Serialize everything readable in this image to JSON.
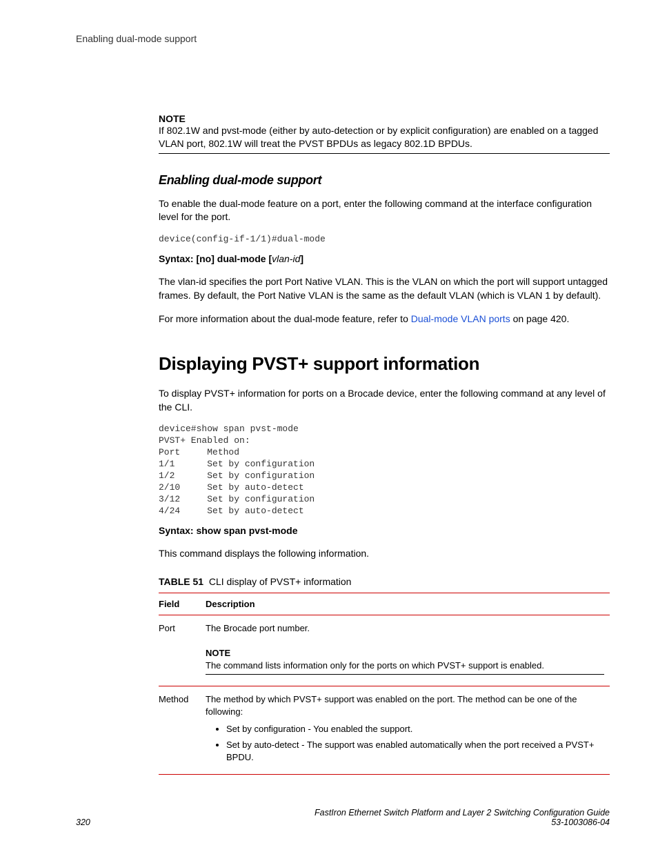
{
  "header": "Enabling dual-mode support",
  "note1": {
    "label": "NOTE",
    "text": "If 802.1W and pvst-mode (either by auto-detection or by explicit configuration) are enabled on a tagged VLAN port, 802.1W will treat the PVST BPDUs as legacy 802.1D BPDUs."
  },
  "section1": {
    "heading": "Enabling dual-mode support",
    "intro": "To enable the dual-mode feature on a port, enter the following command at the interface configuration level for the port.",
    "code": "device(config-if-1/1)#dual-mode",
    "syntax_prefix": "Syntax: [no] dual-mode",
    "syntax_var": "vlan-id",
    "para2": "The vlan-id specifies the port Port Native VLAN. This is the VLAN on which the port will support untagged frames. By default, the Port Native VLAN is the same as the default VLAN (which is VLAN 1 by default).",
    "para3_pre": "For more information about the dual-mode feature, refer to ",
    "para3_link": "Dual-mode VLAN ports",
    "para3_post": " on page 420."
  },
  "section2": {
    "heading": "Displaying PVST+ support information",
    "intro": "To display PVST+ information for ports on a Brocade device, enter the following command at any level of the CLI.",
    "code": "device#show span pvst-mode\nPVST+ Enabled on:\nPort     Method\n1/1      Set by configuration\n1/2      Set by configuration\n2/10     Set by auto-detect\n3/12     Set by configuration\n4/24     Set by auto-detect",
    "syntax": "Syntax: show span pvst-mode",
    "para2": "This command displays the following information.",
    "table_caption_label": "TABLE 51",
    "table_caption_text": "CLI display of PVST+ information",
    "table": {
      "headers": [
        "Field",
        "Description"
      ],
      "row1": {
        "field": "Port",
        "desc": "The Brocade port number.",
        "note_label": "NOTE",
        "note_text": "The command lists information only for the ports on which PVST+ support is enabled."
      },
      "row2": {
        "field": "Method",
        "desc_intro": "The method by which PVST+ support was enabled on the port. The method can be one of the following:",
        "bullet1": "Set by configuration - You enabled the support.",
        "bullet2": "Set by auto-detect - The support was enabled automatically when the port received a PVST+ BPDU."
      }
    }
  },
  "footer": {
    "page": "320",
    "right1": "FastIron Ethernet Switch Platform and Layer 2 Switching Configuration Guide",
    "right2": "53-1003086-04"
  }
}
